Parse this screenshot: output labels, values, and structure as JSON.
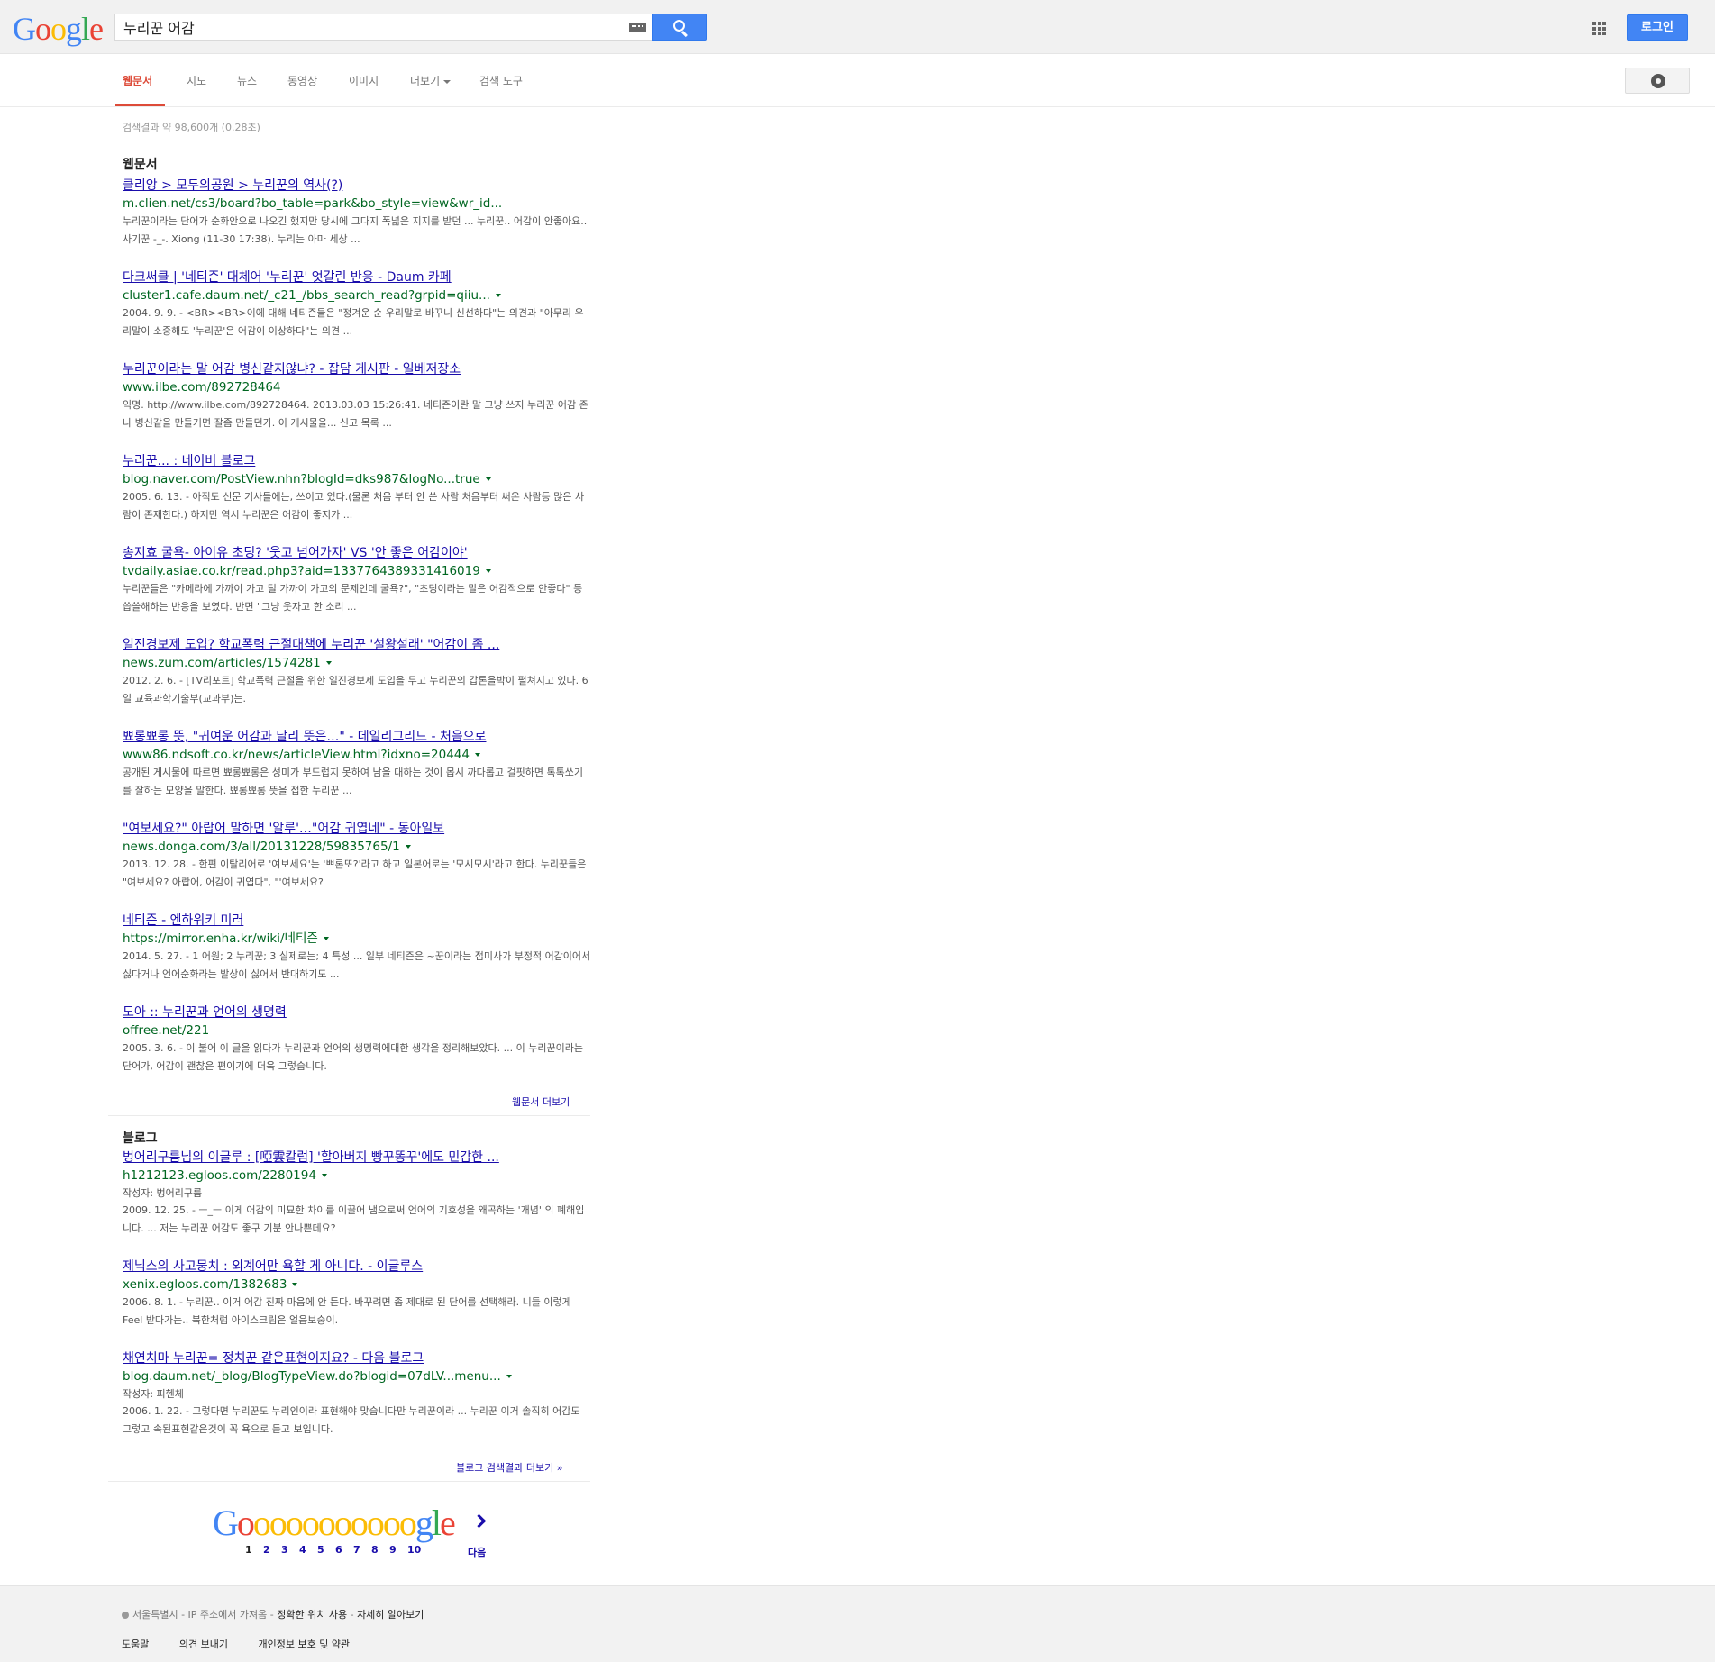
{
  "header": {
    "logo_letters": [
      {
        "ch": "G",
        "color": "#4285f4"
      },
      {
        "ch": "o",
        "color": "#ea4335"
      },
      {
        "ch": "o",
        "color": "#fbbc05"
      },
      {
        "ch": "g",
        "color": "#4285f4"
      },
      {
        "ch": "l",
        "color": "#34a853"
      },
      {
        "ch": "e",
        "color": "#ea4335"
      }
    ],
    "search_query": "누리꾼 어감",
    "keyboard_icon": "keyboard-icon",
    "search_icon": "magnifier-icon",
    "apps_icon": "apps-grid-icon",
    "login_label": "로그인"
  },
  "tabs": {
    "items": [
      "웹문서",
      "지도",
      "뉴스",
      "동영상",
      "이미지",
      "더보기",
      "검색 도구"
    ],
    "active": "웹문서",
    "settings_icon": "gear-icon"
  },
  "stats": "검색결과 약 98,600개 (0.28초)",
  "web": {
    "section_title": "웹문서",
    "results": [
      {
        "title": "클리앙 > 모두의공원 > 누리꾼의 역사(?)",
        "url": "m.clien.net/cs3/board?bo_table=park&bo_style=view&wr_id...",
        "caret": false,
        "meta": "",
        "snippet": "누리꾼이라는 단어가 순화안으로 나오긴 했지만 당시에 그다지 폭넓은 지지를 받던 ... 누리꾼.. 어감이 안좋아요.. 사기꾼 -_-. Xiong (11-30 17:38). 누리는 아마 세상 ..."
      },
      {
        "title": "다크써클 | '네티즌' 대체어 '누리꾼' 엇갈린 반응 - Daum 카페",
        "url": "cluster1.cafe.daum.net/_c21_/bbs_search_read?grpid=qiiu...",
        "caret": true,
        "meta": "",
        "snippet": "2004. 9. 9. - <BR><BR>이에 대해 네티즌들은 \"정겨운 순 우리말로 바꾸니 신선하다\"는 의견과 \"아무리 우리말이 소중해도 '누리꾼'은 어감이 이상하다\"는 의견 ..."
      },
      {
        "title": "누리꾼이라는 말 어감 병신같지않냐? - 잡담 게시판 - 일베저장소",
        "url": "www.ilbe.com/892728464",
        "caret": false,
        "meta": "",
        "snippet": "익명. http://www.ilbe.com/892728464. 2013.03.03 15:26:41. 네티즌이란 말 그냥 쓰지 누리꾼 어감 존나 병신같을 만들거면 잘좀 만들던가. 이 게시물을... 신고 목록 ..."
      },
      {
        "title": "누리꾼... : 네이버 블로그",
        "url": "blog.naver.com/PostView.nhn?blogId=dks987&logNo...true",
        "caret": true,
        "meta": "",
        "snippet": "2005. 6. 13. - 아직도 신문 기사들에는, 쓰이고 있다.(물론 처음 부터 안 쓴 사람 처음부터 써온 사람등 많은 사람이 존재한다.) 하지만 역시 누리꾼은 어감이 좋지가 ..."
      },
      {
        "title": "송지효 굴욕- 아이유 초딩? '웃고 넘어가자' VS '안 좋은 어감이야'",
        "url": "tvdaily.asiae.co.kr/read.php3?aid=1337764389331416019",
        "caret": true,
        "meta": "",
        "snippet": "누리꾼들은 \"카메라에 가까이 가고 덜 가까이 가고의 문제인데 굴욕?\", \"초딩이라는 말은 어감적으로 안좋다\" 등 씁쓸해하는 반응을 보였다. 반면 \"그냥 웃자고 한 소리 ..."
      },
      {
        "title": "일진경보제 도입? 학교폭력 근절대책에 누리꾼 '설왕설래' \"어감이 좀 ...",
        "url": "news.zum.com/articles/1574281",
        "caret": true,
        "meta": "",
        "snippet": "2012. 2. 6. - [TV리포트] 학교폭력 근절을 위한 일진경보제 도입을 두고 누리꾼의 갑론을박이 펼쳐지고 있다. 6일 교육과학기술부(교과부)는."
      },
      {
        "title": "뾰롱뾰롱 뜻, \"귀여운 어감과 달리 뜻은…\" - 데일리그리드 - 처음으로",
        "url": "www86.ndsoft.co.kr/news/articleView.html?idxno=20444",
        "caret": true,
        "meta": "",
        "snippet": "공개된 게시물에 따르면 뾰롱뾰롱은 성미가 부드럽지 못하여 남을 대하는 것이 몹시 까다롭고 걸핏하면 톡톡쏘기를 잘하는 모양을 말한다. 뾰롱뾰롱 뜻을 접한 누리꾼 ..."
      },
      {
        "title": "\"여보세요?\" 아랍어 말하면 '알루'…\"어감 귀엽네\" - 동아일보",
        "url": "news.donga.com/3/all/20131228/59835765/1",
        "caret": true,
        "meta": "",
        "snippet": "2013. 12. 28. - 한편 이탈리어로 '여보세요'는 '쁘론또?'라고 하고 일본어로는 '모시모시'라고 한다. 누리꾼들은 \"여보세요? 아랍어, 어감이 귀엽다\", \"'여보세요?"
      },
      {
        "title": "네티즌 - 엔하위키 미러",
        "url": "https://mirror.enha.kr/wiki/네티즌",
        "caret": true,
        "meta": "",
        "snippet": "2014. 5. 27. - 1 어원; 2 누리꾼; 3 실제로는; 4 특성 ... 일부 네티즌은 ~꾼이라는 접미사가 부정적 어감이어서 싫다거나 언어순화라는 발상이 싫어서 반대하기도 ..."
      },
      {
        "title": "도아 :: 누리꾼과 언어의 생명력",
        "url": "offree.net/221",
        "caret": false,
        "meta": "",
        "snippet": "2005. 3. 6. - 이 불어 이 글을 읽다가 누리꾼과 언어의 생명력에대한 생각을 정리해보았다. ... 이 누리꾼이라는 단어가, 어감이 괜찮은 편이기에 더욱 그렇습니다."
      }
    ],
    "more_label": "웹문서 더보기"
  },
  "blog": {
    "section_title": "블로그",
    "results": [
      {
        "title": "벙어리구름님의 이글루 : [啞雲칼럼] '할아버지 빵꾸똥꾸'에도 민감한 ...",
        "url": "h1212123.egloos.com/2280194",
        "caret": true,
        "meta": "작성자: 벙어리구름",
        "snippet": "2009. 12. 25. - ㅡ_ㅡ 이게 어감의 미묘한 차이를 이끌어 냄으로써 언어의 기호성을 왜곡하는 '개념' 의 폐해입니다. ... 저는 누리꾼 어감도 좋구 기분 안나쁜데요?"
      },
      {
        "title": "제닉스의 사고뭉치 : 외계어만 욕할 게 아니다. - 이글루스",
        "url": "xenix.egloos.com/1382683",
        "caret": true,
        "meta": "",
        "snippet": "2006. 8. 1. - 누리꾼.. 이거 어감 진짜 마음에 안 든다. 바꾸려면 좀 제대로 된 단어를 선택해라. 니들 이렇게 Feel 받다가는.. 북한처럼 아이스크림은 얼음보숭이."
      },
      {
        "title": "채연치마 누리꾼= 정치꾼 같은표현이지요? - 다음 블로그",
        "url": "blog.daum.net/_blog/BlogTypeView.do?blogid=07dLV...menu...",
        "caret": true,
        "meta": "작성자: 피헨체",
        "snippet": "2006. 1. 22. - 그렇다면 누리꾼도 누리인이라 표현해야 맞습니다만 누리꾼이라 ... 누리꾼 이거 솔직히 어감도 그렇고 속된표현같은것이 꼭 욕으로 듣고 보입니다."
      }
    ],
    "more_label": "블로그 검색결과 더보기 »"
  },
  "pagination": {
    "logo": "Gooooooooooogle",
    "pages": [
      "1",
      "2",
      "3",
      "4",
      "5",
      "6",
      "7",
      "8",
      "9",
      "10"
    ],
    "current": "1",
    "next_label": "다음"
  },
  "footer": {
    "location": "서울특별시 - IP 주소에서 가져옴",
    "location_link1": "정확한 위치 사용",
    "location_link2": "자세히 알아보기",
    "links": [
      "도움말",
      "의견 보내기",
      "개인정보 보호 및 약관"
    ]
  }
}
